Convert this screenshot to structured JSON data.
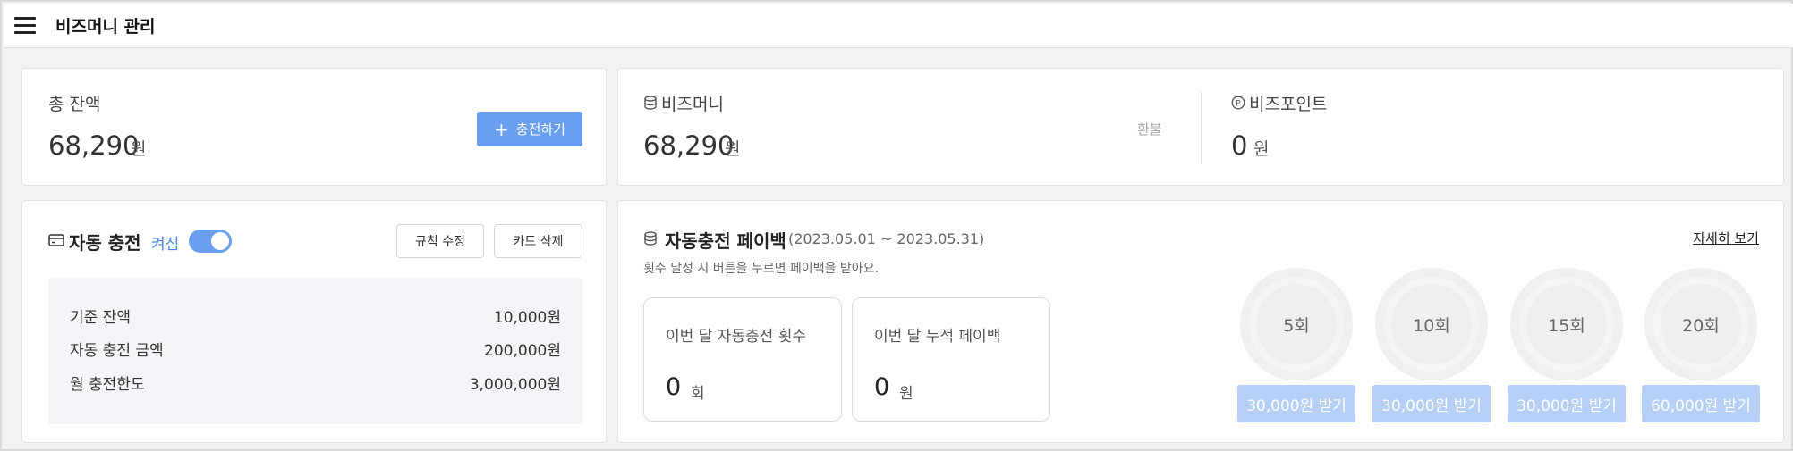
{
  "header": {
    "title": "비즈머니 관리"
  },
  "total": {
    "label": "총 잔액",
    "amount": "68,290",
    "unit": "원",
    "charge_label": "충전하기"
  },
  "bizmoney": {
    "label": "비즈머니",
    "amount": "68,290",
    "unit": "원",
    "refund_label": "환불"
  },
  "bizpoint": {
    "label": "비즈포인트",
    "amount": "0",
    "unit": "원"
  },
  "auto_charge": {
    "title": "자동 충전",
    "status": "켜짐",
    "toggle_on": true,
    "edit_rule_label": "규칙 수정",
    "delete_card_label": "카드 삭제",
    "rules": [
      {
        "key": "기준 잔액",
        "value": "10,000원"
      },
      {
        "key": "자동 충전 금액",
        "value": "200,000원"
      },
      {
        "key": "월 충전한도",
        "value": "3,000,000원"
      }
    ]
  },
  "payback": {
    "title": "자동충전 페이백",
    "period": "(2023.05.01 ~ 2023.05.31)",
    "desc": "횟수 달성 시 버튼을 누르면 페이백을 받아요.",
    "detail_link": "자세히 보기",
    "count_card": {
      "label": "이번 달 자동충전 횟수",
      "value": "0",
      "unit": "회"
    },
    "total_card": {
      "label": "이번 달 누적 페이백",
      "value": "0",
      "unit": "원"
    },
    "milestones": [
      {
        "count": "5회",
        "button": "30,000원 받기"
      },
      {
        "count": "10회",
        "button": "30,000원 받기"
      },
      {
        "count": "15회",
        "button": "30,000원 받기"
      },
      {
        "count": "20회",
        "button": "60,000원 받기"
      }
    ]
  },
  "icons": {
    "menu": "hamburger-icon",
    "plus": "plus-icon",
    "database": "database-icon",
    "point": "point-circle-icon",
    "card": "credit-card-icon"
  },
  "colors": {
    "accent": "#6a9ff0",
    "reward_disabled": "#b6d0f7"
  }
}
